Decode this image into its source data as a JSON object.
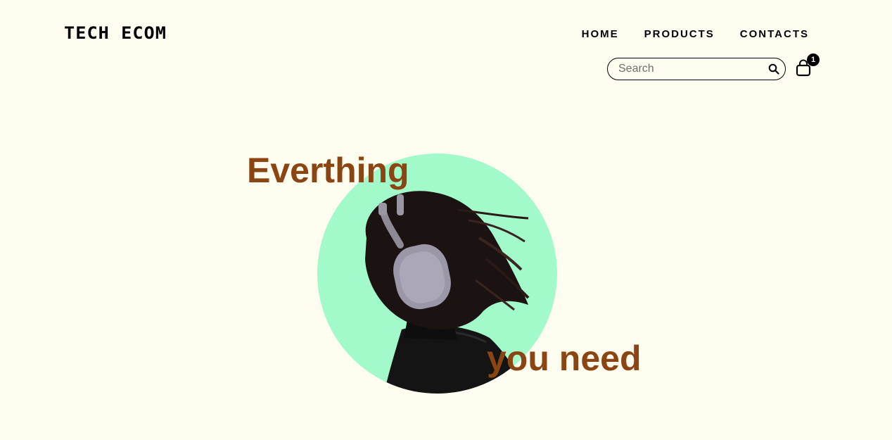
{
  "brand": {
    "logo_text": "TECH ECOM"
  },
  "nav": {
    "items": [
      {
        "label": "HOME"
      },
      {
        "label": "PRODUCTS"
      },
      {
        "label": "CONTACTS"
      }
    ]
  },
  "search": {
    "placeholder": "Search",
    "value": "",
    "icon": "search-icon"
  },
  "cart": {
    "icon": "shopping-bag-icon",
    "count": "1"
  },
  "hero": {
    "title_top": "Everthing",
    "title_bottom": "you need",
    "image": "person-with-headphones",
    "circle_color": "#a2f9c9",
    "title_color": "#8b4512"
  },
  "colors": {
    "background": "#fffdf0",
    "text": "#000000"
  }
}
